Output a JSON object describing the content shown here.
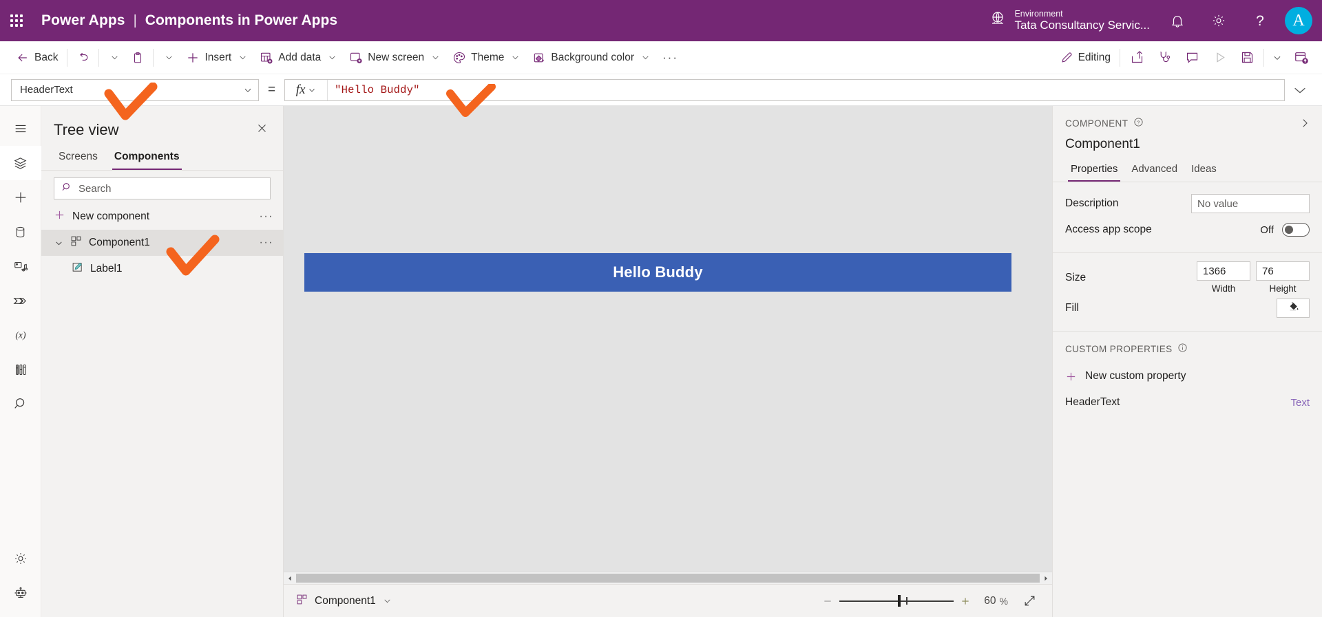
{
  "topbar": {
    "waffle_icon": "app-launcher-icon",
    "brand_name": "Power Apps",
    "brand_separator": "|",
    "app_title": "Components in Power Apps",
    "environment_label": "Environment",
    "environment_value": "Tata Consultancy Servic...",
    "globe_icon": "environment-globe-icon",
    "notification_icon": "bell-icon",
    "settings_icon": "gear-icon",
    "help_icon": "question-mark-icon",
    "avatar_initial": "A",
    "accent_color": "#742774",
    "avatar_color": "#00aee0"
  },
  "commandbar": {
    "back": "Back",
    "undo_icon": "undo-icon",
    "undo_chevron": "chevron-down-icon",
    "paste_icon": "clipboard-icon",
    "paste_chevron": "chevron-down-icon",
    "insert": "Insert",
    "add_data": "Add data",
    "new_screen": "New screen",
    "theme": "Theme",
    "background_color": "Background color",
    "overflow": "···",
    "editing": "Editing",
    "pencil_icon": "pencil-icon",
    "share_icon": "share-icon",
    "checker_icon": "stethoscope-app-checker-icon",
    "comment_icon": "comment-icon",
    "preview_icon": "play-preview-icon",
    "save_icon": "save-disk-icon",
    "save_chevron": "chevron-down-icon",
    "publish_icon": "publish-icon"
  },
  "formulabar": {
    "property": "HeaderText",
    "property_chevron": "chevron-down-icon",
    "equals": "=",
    "fx_glyph": "fx",
    "fx_chevron": "chevron-down-icon",
    "formula": "\"Hello Buddy\"",
    "expand_icon": "chevron-down-expand-icon"
  },
  "rail": {
    "items": [
      {
        "name": "hamburger-menu-icon",
        "icon": "hamburger",
        "active": false
      },
      {
        "name": "tree-view-icon",
        "icon": "layers",
        "active": true
      },
      {
        "name": "insert-icon",
        "icon": "plus",
        "active": false
      },
      {
        "name": "data-icon",
        "icon": "database",
        "active": false
      },
      {
        "name": "media-icon",
        "icon": "media",
        "active": false
      },
      {
        "name": "power-automate-icon",
        "icon": "flow",
        "active": false
      },
      {
        "name": "variables-icon",
        "icon": "variables",
        "active": false
      },
      {
        "name": "experimental-tools-icon",
        "icon": "tools",
        "active": false
      },
      {
        "name": "search-icon",
        "icon": "search",
        "active": false
      }
    ],
    "bottom": [
      {
        "name": "settings-gear-icon",
        "icon": "gear"
      },
      {
        "name": "copilot-robot-icon",
        "icon": "robot"
      }
    ]
  },
  "treeview": {
    "title": "Tree view",
    "close_icon": "close-icon",
    "tabs": [
      {
        "label": "Screens",
        "active": false
      },
      {
        "label": "Components",
        "active": true
      }
    ],
    "search_placeholder": "Search",
    "search_value": "",
    "search_icon": "search-icon",
    "new_component": "New component",
    "new_component_plus": "+",
    "new_component_overflow": "···",
    "nodes": [
      {
        "label": "Component1",
        "icon": "component-icon",
        "selected": true,
        "expanded": true,
        "overflow": "···",
        "children": [
          {
            "label": "Label1",
            "icon": "label-icon",
            "selected": false
          }
        ]
      }
    ]
  },
  "canvas": {
    "label_text": "Hello Buddy",
    "label_fill": "#3a60b4",
    "label_text_color": "#ffffff",
    "background": "#e3e3e3",
    "scroll_left_arrow": "◀",
    "scroll_right_arrow": "▶"
  },
  "statusbar": {
    "component_name": "Component1",
    "component_icon": "component-icon",
    "component_chevron": "chevron-down-icon",
    "zoom_out_icon": "minus-icon",
    "zoom_in_icon": "plus-icon",
    "zoom_value": "60",
    "zoom_unit": "%",
    "fit_icon": "fit-to-screen-icon"
  },
  "properties": {
    "kicker": "COMPONENT",
    "kicker_help_icon": "help-circle-icon",
    "collapse_icon": "chevron-right-icon",
    "name": "Component1",
    "tabs": [
      {
        "label": "Properties",
        "active": true
      },
      {
        "label": "Advanced",
        "active": false
      },
      {
        "label": "Ideas",
        "active": false
      }
    ],
    "description_label": "Description",
    "description_placeholder": "No value",
    "description_value": "",
    "access_app_scope_label": "Access app scope",
    "access_app_scope_state": "Off",
    "size_label": "Size",
    "width_value": "1366",
    "width_caption": "Width",
    "height_value": "76",
    "height_caption": "Height",
    "fill_label": "Fill",
    "fill_icon": "paint-bucket-icon",
    "custom_properties_title": "CUSTOM PROPERTIES",
    "custom_properties_info_icon": "info-circle-icon",
    "new_custom_property": "New custom property",
    "new_custom_property_plus": "+",
    "custom_property_rows": [
      {
        "name": "HeaderText",
        "type": "Text"
      }
    ]
  },
  "annotations": {
    "color": "#f4641e",
    "marks": [
      "check-mark-property-dropdown",
      "check-mark-formula",
      "check-mark-component-node"
    ]
  }
}
